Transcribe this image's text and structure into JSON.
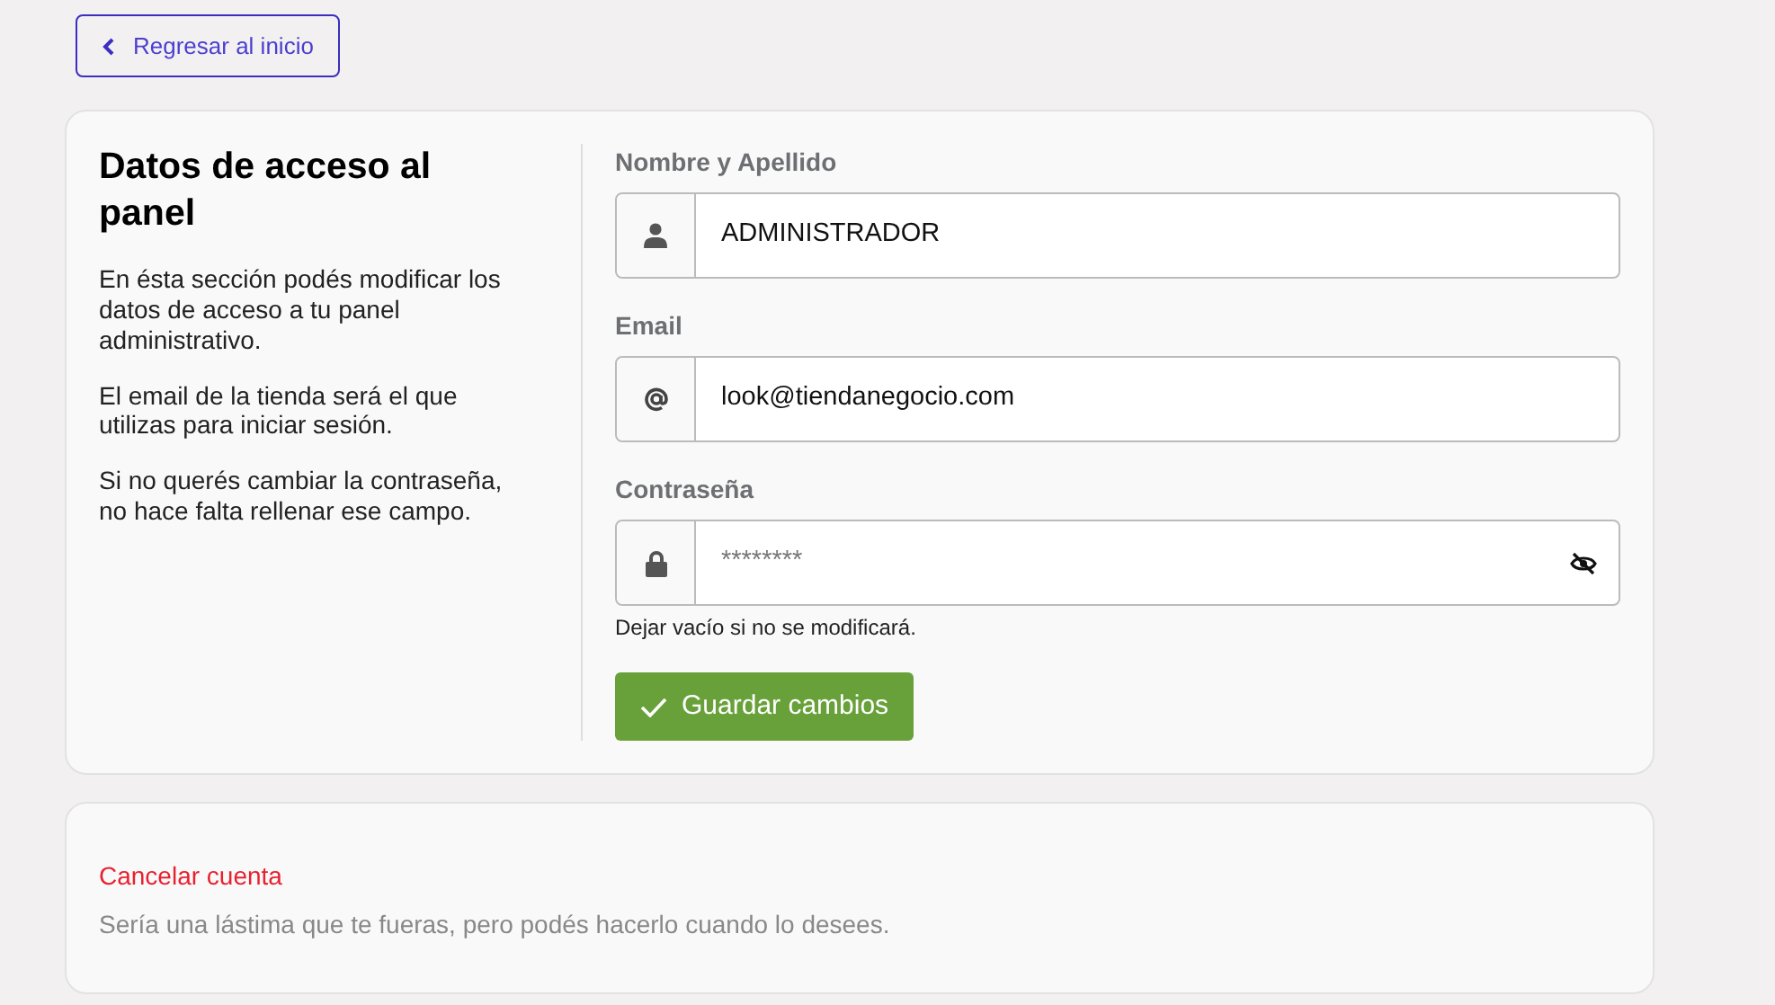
{
  "back_button": {
    "label": "Regresar al inicio"
  },
  "access_panel": {
    "title": "Datos de acceso al panel",
    "paragraphs": [
      "En ésta sección podés modificar los datos de acceso a tu panel administrativo.",
      "El email de la tienda será el que utilizas para iniciar sesión.",
      "Si no querés cambiar la contraseña, no hace falta rellenar ese campo."
    ],
    "fields": [
      {
        "kind": "name",
        "label": "Nombre y Apellido",
        "value": "ADMINISTRADOR"
      },
      {
        "kind": "email",
        "label": "Email",
        "value": "look@tiendanegocio.com"
      },
      {
        "kind": "password",
        "label": "Contraseña",
        "placeholder": "********",
        "help": "Dejar vacío si no se modificará."
      }
    ],
    "save_button": {
      "label": "Guardar cambios"
    }
  },
  "cancel_panel": {
    "title": "Cancelar cuenta",
    "text": "Sería una lástima que te fueras, pero podés hacerlo cuando lo desees."
  }
}
